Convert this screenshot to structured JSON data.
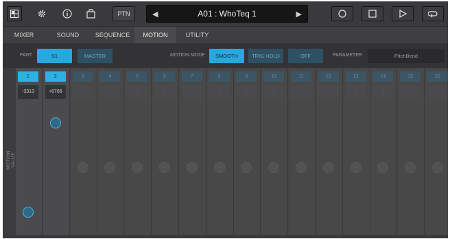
{
  "toolbar": {
    "ptn_label": "PTN",
    "pattern_name": "A01 : WhoTeq 1"
  },
  "tabs": [
    {
      "label": "MIXER",
      "active": false
    },
    {
      "label": "SOUND",
      "active": false
    },
    {
      "label": "SEQUENCE",
      "active": false
    },
    {
      "label": "MOTION",
      "active": true
    },
    {
      "label": "UTILITY",
      "active": false
    }
  ],
  "controls": {
    "part_label": "PART",
    "part_s1": "S1",
    "part_master": "MASTER",
    "motion_mode_label": "MOTION MODE",
    "mode_smooth": "SMOOTH",
    "mode_trig_hold": "TRIG HOLD",
    "mode_off": "OFF",
    "parameter_label": "PARAMETER",
    "parameter_value": "PitchBend"
  },
  "grid": {
    "axis_label": "MOTION VALUE",
    "steps": [
      {
        "num": "1",
        "value": "-3313",
        "active": true,
        "level": 0.12
      },
      {
        "num": "2",
        "value": "+6766",
        "active": true,
        "level": 0.88
      },
      {
        "num": "3",
        "value": "0",
        "active": false,
        "level": 0.5
      },
      {
        "num": "4",
        "value": "0",
        "active": false,
        "level": 0.5
      },
      {
        "num": "5",
        "value": "0",
        "active": false,
        "level": 0.5
      },
      {
        "num": "6",
        "value": "0",
        "active": false,
        "level": 0.5
      },
      {
        "num": "7",
        "value": "0",
        "active": false,
        "level": 0.5
      },
      {
        "num": "8",
        "value": "0",
        "active": false,
        "level": 0.5
      },
      {
        "num": "9",
        "value": "0",
        "active": false,
        "level": 0.5
      },
      {
        "num": "10",
        "value": "0",
        "active": false,
        "level": 0.5
      },
      {
        "num": "11",
        "value": "0",
        "active": false,
        "level": 0.5
      },
      {
        "num": "12",
        "value": "0",
        "active": false,
        "level": 0.5
      },
      {
        "num": "13",
        "value": "0",
        "active": false,
        "level": 0.5
      },
      {
        "num": "14",
        "value": "0",
        "active": false,
        "level": 0.5
      },
      {
        "num": "15",
        "value": "0",
        "active": false,
        "level": 0.5
      },
      {
        "num": "16",
        "value": "0",
        "active": false,
        "level": 0.5
      }
    ]
  }
}
